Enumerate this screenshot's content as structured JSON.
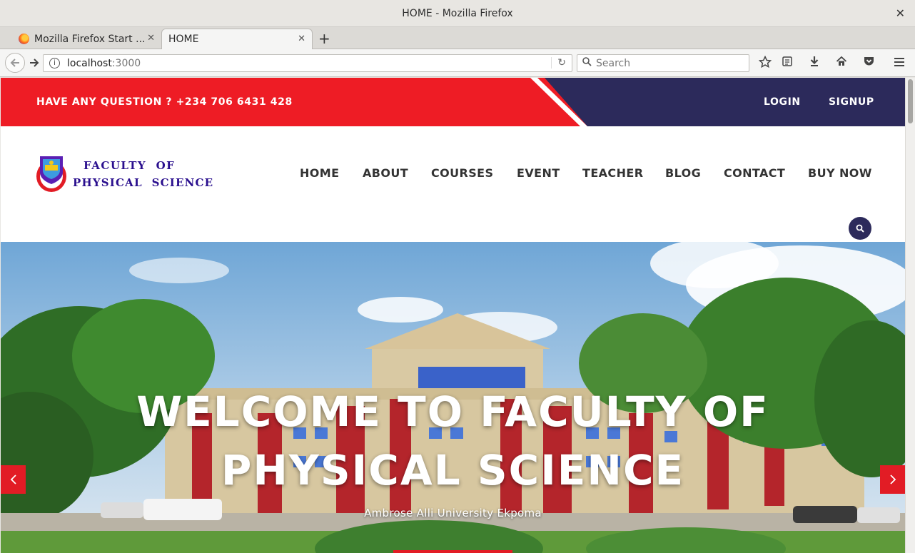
{
  "window": {
    "title": "HOME - Mozilla Firefox"
  },
  "tabs": [
    {
      "label": "Mozilla Firefox Start ...",
      "active": false
    },
    {
      "label": "HOME",
      "active": true
    }
  ],
  "toolbar": {
    "url_host": "localhost",
    "url_port": ":3000",
    "search_placeholder": "Search"
  },
  "topbar": {
    "question": "HAVE ANY QUESTION ? +234 706 6431 428",
    "login": "LOGIN",
    "signup": "SIGNUP",
    "colors": {
      "red": "#ee1c25",
      "navy": "#2c2a5b"
    }
  },
  "logo": {
    "line1": "FACULTY  OF",
    "line2": "PHYSICAL  SCIENCE"
  },
  "nav": {
    "items": [
      "HOME",
      "ABOUT",
      "COURSES",
      "EVENT",
      "TEACHER",
      "BLOG",
      "CONTACT",
      "BUY NOW"
    ]
  },
  "hero": {
    "title_line1": "WELCOME TO FACULTY OF",
    "title_line2": "PHYSICAL SCIENCE",
    "subtitle": "Ambrose Alli University Ekpoma",
    "prev_icon": "chevron-left-icon",
    "next_icon": "chevron-right-icon"
  }
}
